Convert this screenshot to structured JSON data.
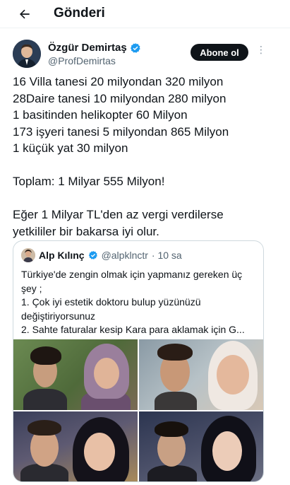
{
  "header": {
    "title": "Gönderi"
  },
  "author": {
    "name": "Özgür Demirtaş",
    "handle": "@ProfDemirtas",
    "follow_label": "Abone ol"
  },
  "tweet": {
    "lines": [
      "16 Villa tanesi 20 milyondan 320 milyon",
      "28Daire tanesi 10 milyondan 280 milyon",
      "1 basitinden helikopter 60 Milyon",
      "173 işyeri tanesi 5 milyondan 865 Milyon",
      "1 küçük yat 30 milyon"
    ],
    "total": "Toplam: 1 Milyar 555 Milyon!",
    "closing_lines": [
      "Eğer 1 Milyar TL'den az vergi verdilerse",
      "yetkililer bir bakarsa iyi olur."
    ]
  },
  "quote": {
    "name": "Alp Kılınç",
    "handle": "@alpklnctr",
    "time": "· 10 sa",
    "lines": [
      "Türkiye'de zengin olmak için yapmanız gereken üç",
      "şey ;",
      "1. Çok iyi estetik doktoru bulup yüzünüzü",
      "değiştiriyorsunuz",
      "2. Sahte faturalar kesip Kara para aklamak için G..."
    ]
  },
  "icons": {
    "back": "arrow-left-icon",
    "verified": "verified-badge-icon",
    "more": "more-options-icon"
  },
  "colors": {
    "verified_blue": "#1d9bf0",
    "follow_bg": "#0f1419",
    "secondary_text": "#536471",
    "border": "#cfd9de"
  }
}
